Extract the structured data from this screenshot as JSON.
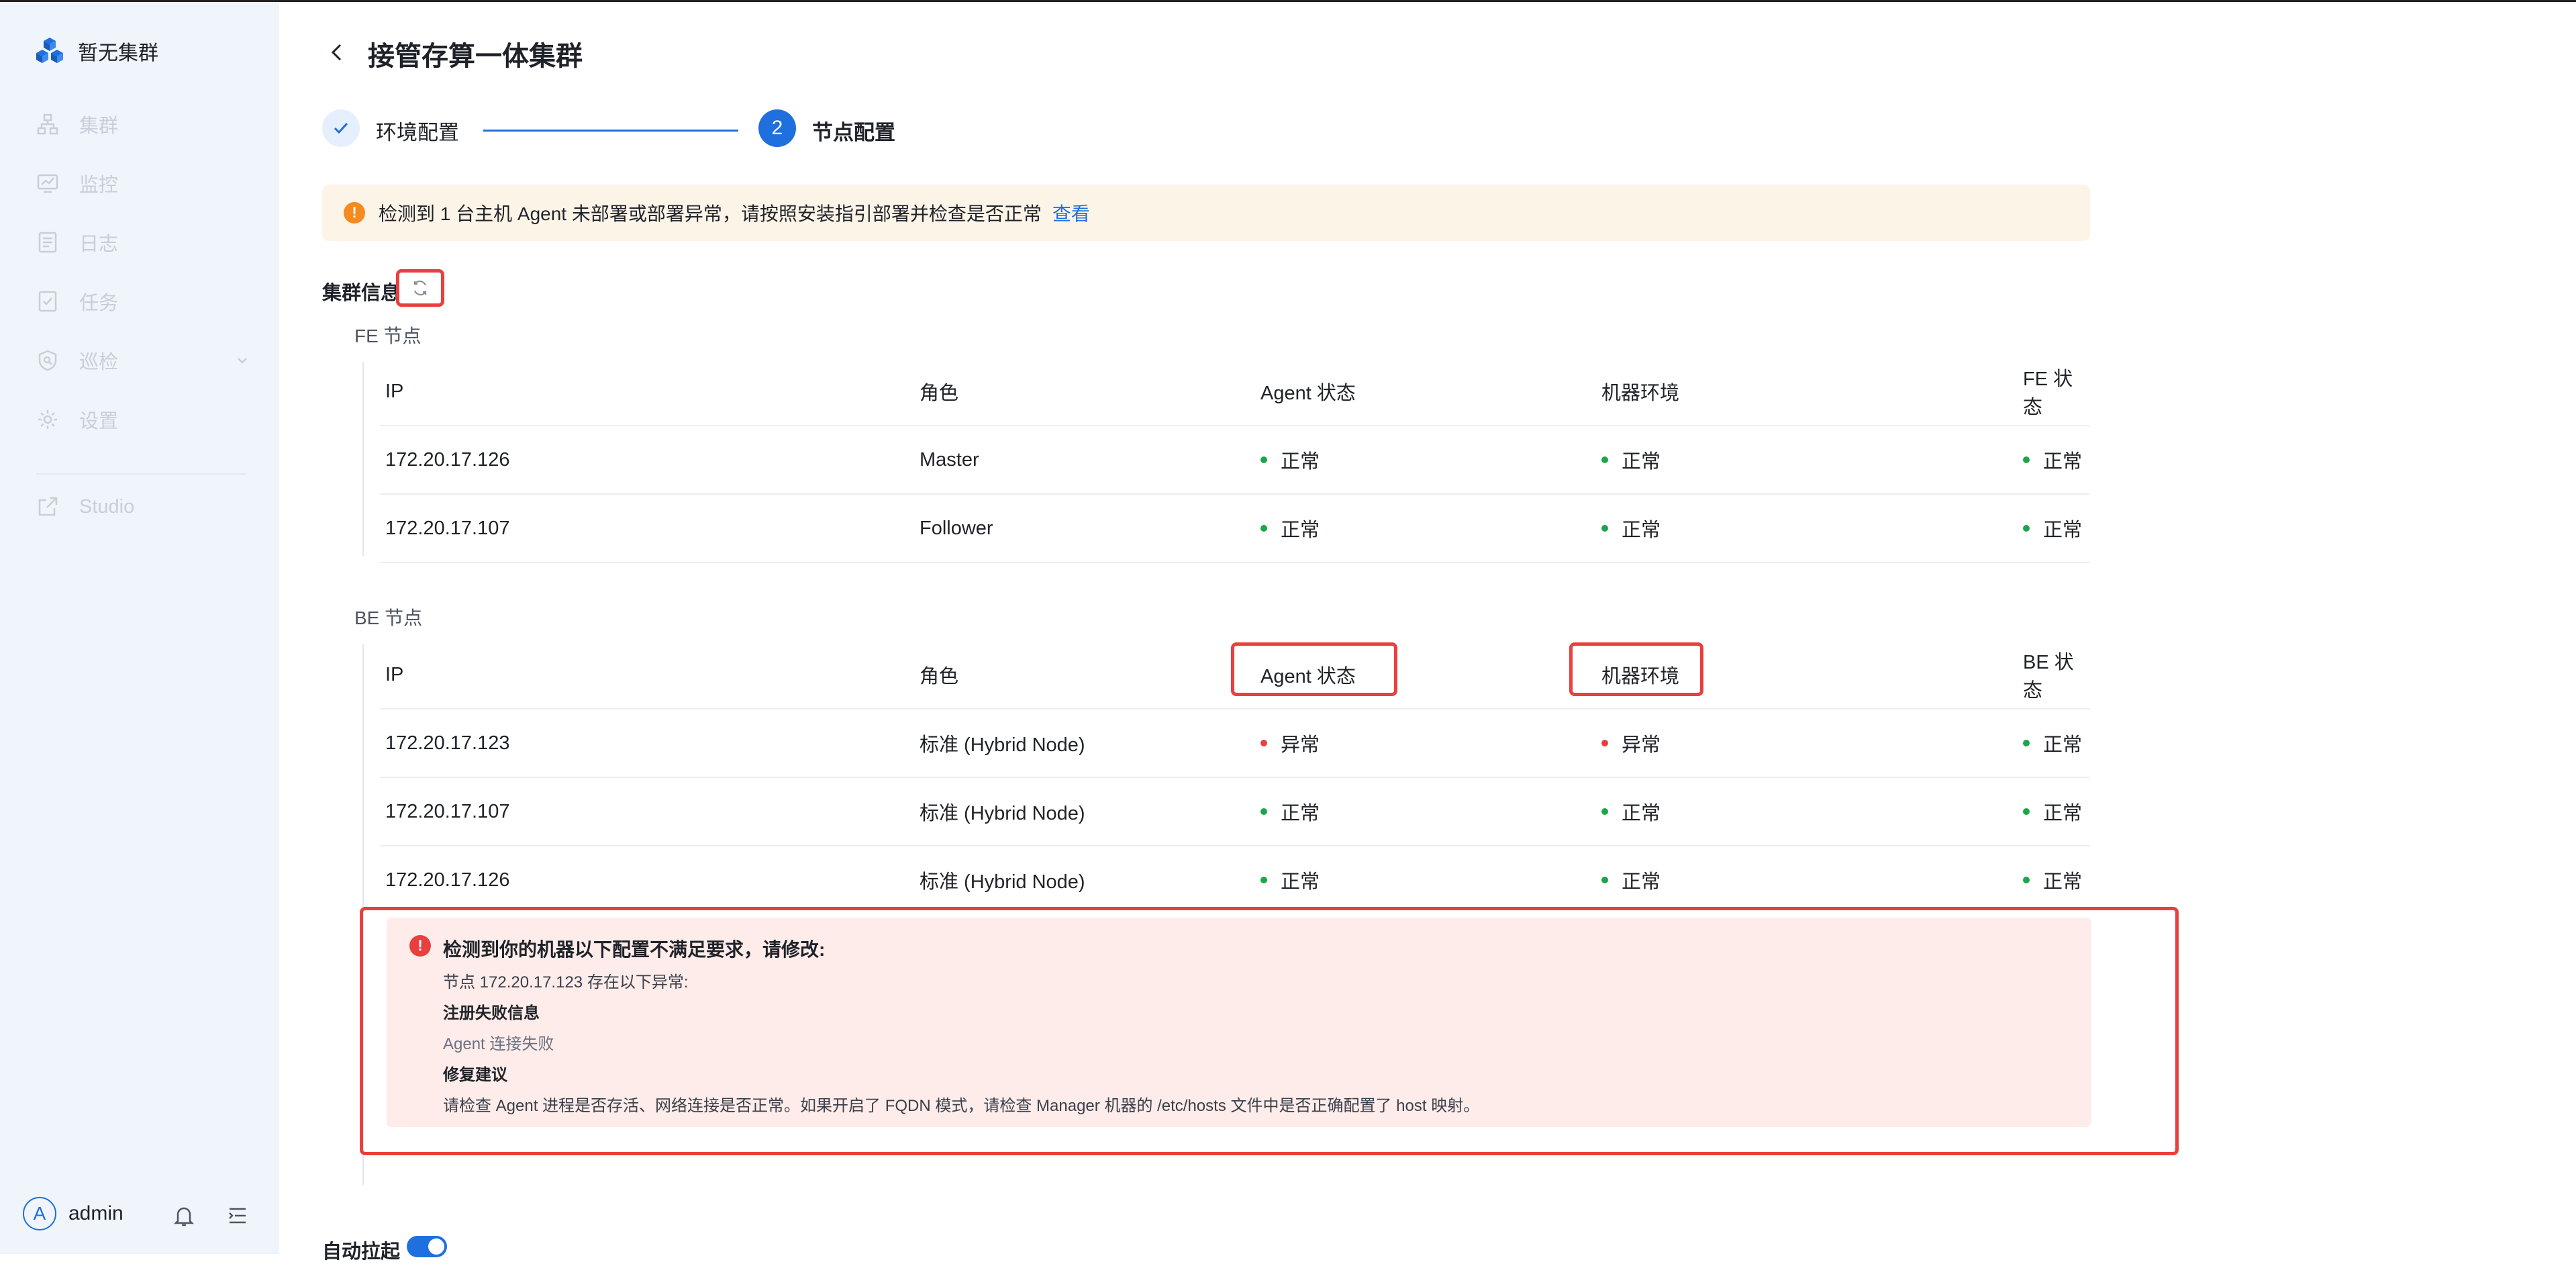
{
  "brand": {
    "name": "暂无集群"
  },
  "sidebar": {
    "items": [
      {
        "label": "集群",
        "icon": "cluster-icon"
      },
      {
        "label": "监控",
        "icon": "monitor-icon"
      },
      {
        "label": "日志",
        "icon": "log-icon"
      },
      {
        "label": "任务",
        "icon": "task-icon"
      },
      {
        "label": "巡检",
        "icon": "inspect-icon"
      },
      {
        "label": "设置",
        "icon": "gear-icon"
      },
      {
        "label": "Studio",
        "icon": "external-link-icon"
      }
    ],
    "user": {
      "avatar_letter": "A",
      "name": "admin"
    }
  },
  "page": {
    "title": "接管存算一体集群"
  },
  "steps": [
    {
      "label": "环境配置",
      "state": "done"
    },
    {
      "number": "2",
      "label": "节点配置",
      "state": "active"
    }
  ],
  "alert": {
    "icon": "!",
    "message": "检测到 1 台主机 Agent 未部署或部署异常，请按照安装指引部署并检查是否正常",
    "link": "查看"
  },
  "cluster": {
    "title": "集群信息"
  },
  "fe": {
    "title": "FE 节点",
    "headers": {
      "ip": "IP",
      "role": "角色",
      "agent": "Agent 状态",
      "env": "机器环境",
      "status": "FE 状态"
    },
    "rows": [
      {
        "ip": "172.20.17.126",
        "role": "Master",
        "agent": "正常",
        "env": "正常",
        "status": "正常"
      },
      {
        "ip": "172.20.17.107",
        "role": "Follower",
        "agent": "正常",
        "env": "正常",
        "status": "正常"
      }
    ]
  },
  "be": {
    "title": "BE 节点",
    "headers": {
      "ip": "IP",
      "role": "角色",
      "agent": "Agent 状态",
      "env": "机器环境",
      "status": "BE 状态"
    },
    "rows": [
      {
        "ip": "172.20.17.123",
        "role": "标准 (Hybrid Node)",
        "agent": "异常",
        "env": "异常",
        "status": "正常"
      },
      {
        "ip": "172.20.17.107",
        "role": "标准 (Hybrid Node)",
        "agent": "正常",
        "env": "正常",
        "status": "正常"
      },
      {
        "ip": "172.20.17.126",
        "role": "标准 (Hybrid Node)",
        "agent": "正常",
        "env": "正常",
        "status": "正常"
      }
    ]
  },
  "error": {
    "icon": "!",
    "title": "检测到你的机器以下配置不满足要求，请修改:",
    "node_line": "节点 172.20.17.123 存在以下异常:",
    "reg_title": "注册失败信息",
    "reg_detail": "Agent 连接失败",
    "fix_title": "修复建议",
    "fix_detail": "请检查 Agent 进程是否存活、网络连接是否正常。如果开启了 FQDN 模式，请检查 Manager 机器的 /etc/hosts 文件中是否正确配置了 host 映射。"
  },
  "auto_start": {
    "label": "自动拉起",
    "enabled": true
  },
  "colors": {
    "primary": "#1f6fde",
    "success": "#1aa64a",
    "danger": "#e8403f",
    "warning": "#f58b1f"
  }
}
